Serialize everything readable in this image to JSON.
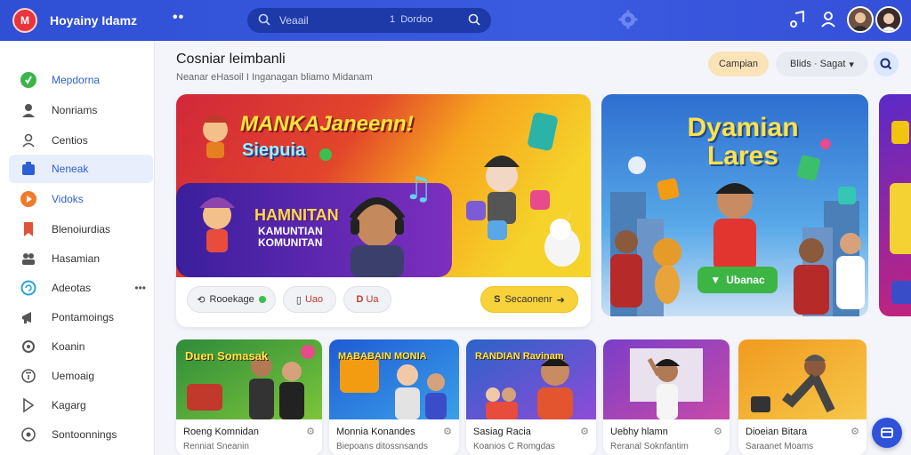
{
  "topbar": {
    "logo_text": "M",
    "app_title": "Hoyainy Idamz",
    "search": {
      "placeholder": "Veaail",
      "secondary": "Dordoo"
    }
  },
  "sidebar": {
    "items": [
      {
        "label": "Mepdorna",
        "icon": "home-icon"
      },
      {
        "label": "Nonriams",
        "icon": "user-icon"
      },
      {
        "label": "Centios",
        "icon": "people-icon"
      },
      {
        "label": "Neneak",
        "icon": "grid-icon"
      },
      {
        "label": "Vidoks",
        "icon": "play-icon"
      },
      {
        "label": "Blenoiurdias",
        "icon": "bookmark-icon"
      },
      {
        "label": "Hasamian",
        "icon": "group-icon"
      },
      {
        "label": "Adeotas",
        "icon": "sync-icon"
      },
      {
        "label": "Pontamoings",
        "icon": "megaphone-icon"
      },
      {
        "label": "Koanin",
        "icon": "gear-icon"
      },
      {
        "label": "Uemoaig",
        "icon": "info-icon"
      },
      {
        "label": "Kagarg",
        "icon": "send-icon"
      },
      {
        "label": "Sontoonnings",
        "icon": "settings-icon"
      }
    ]
  },
  "main": {
    "title": "Cosniar leimbanli",
    "subtitle": "Neanar eHasoil I Inganagan bliamo Midanam",
    "campaign_button": "Campian",
    "filter_button": "Blids · Sagat"
  },
  "hero": {
    "title": "MANKAJaneenn!",
    "subtitle": "Siepuia",
    "panel_title": "HAMNITAN",
    "panel_sub": "KAMUNTIAN KOMUNITAN",
    "chips": [
      "Rooekage",
      "Uao",
      "Ua"
    ],
    "cta": "Secaonenr"
  },
  "feature": {
    "title": "Dyamian Lares",
    "button": "Ubanac"
  },
  "cards": [
    {
      "banner": "Duen Somasak",
      "title": "Roeng Komnidan",
      "sub": "Renniat Sneanin"
    },
    {
      "banner": "MABABAIN MONIA",
      "title": "Monnia Konandes",
      "sub": "Biepoans ditossnsands"
    },
    {
      "banner": "RANDIAN Ravinam",
      "title": "Sasiag Racia",
      "sub": "Koanios C Romgdas"
    },
    {
      "banner": "",
      "title": "Uebhy hlamn",
      "sub": "Reranal Soknfantim"
    },
    {
      "banner": "",
      "title": "Dioeian Bitara",
      "sub": "Saraanet Moams"
    }
  ],
  "colors": {
    "topbar": "#3a5be0",
    "accent": "#2f52d8",
    "cta": "#f7d23b",
    "green": "#3db545"
  }
}
